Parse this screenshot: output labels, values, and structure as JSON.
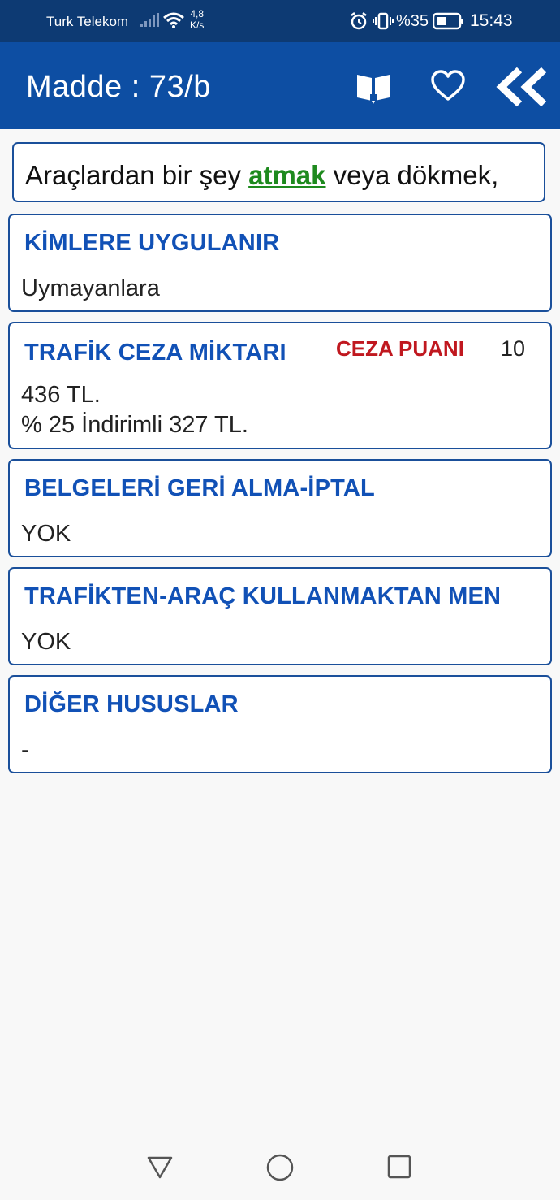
{
  "status_bar": {
    "carrier": "Turk Telekom",
    "speed_value": "4,8",
    "speed_unit": "K/s",
    "battery_percent": "%35",
    "time": "15:43"
  },
  "app_bar": {
    "title": "Madde : 73/b",
    "icons": [
      "book-icon",
      "heart-icon",
      "double-chevron-left-icon"
    ]
  },
  "description": {
    "before": "Araçlardan bir şey ",
    "highlight": "atmak",
    "after": " veya dökmek,"
  },
  "cards": {
    "kimlere": {
      "title": "KİMLERE UYGULANIR",
      "value": "Uymayanlara"
    },
    "ceza": {
      "title": "TRAFİK CEZA MİKTARI",
      "points_label": "CEZA PUANI",
      "points_value": "10",
      "line1": "436 TL.",
      "line2": "% 25 İndirimli 327 TL."
    },
    "belgeler": {
      "title": "BELGELERİ GERİ ALMA-İPTAL",
      "value": "YOK"
    },
    "men": {
      "title": "TRAFİKTEN-ARAÇ KULLANMAKTAN MEN",
      "value": "YOK"
    },
    "diger": {
      "title": "DİĞER HUSUSLAR",
      "value": "-"
    }
  },
  "colors": {
    "status_bar": "#0d3a73",
    "app_bar": "#0d4ea3",
    "card_title": "#1151b6",
    "highlight": "#1e8a1e",
    "points_label": "#c0181f"
  }
}
